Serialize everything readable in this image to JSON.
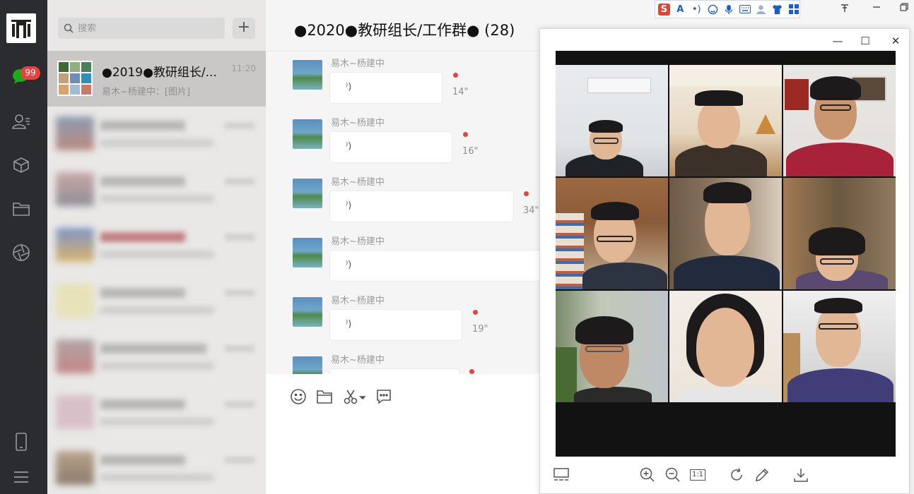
{
  "sidebar": {
    "unread_count": "99",
    "icons": [
      "chat-icon",
      "contacts-icon",
      "favorites-icon",
      "files-icon",
      "moments-icon",
      "phone-icon",
      "menu-icon"
    ]
  },
  "search": {
    "placeholder": "搜索",
    "add_label": "+"
  },
  "conversations": {
    "active": {
      "name": "●2019●教研组长/...",
      "time": "11:20",
      "preview": "易木~杨建中：[图片]"
    }
  },
  "chat": {
    "title": "●2020●教研组长/工作群● (28)",
    "messages": [
      {
        "sender": "易木~杨建中",
        "duration": "14\"",
        "wave": "⁾)"
      },
      {
        "sender": "易木~杨建中",
        "duration": "16\"",
        "wave": "⁾)"
      },
      {
        "sender": "易木~杨建中",
        "duration": "34\"",
        "wave": "⁾)"
      },
      {
        "sender": "易木~杨建中",
        "duration": "",
        "wave": "⁾)"
      },
      {
        "sender": "易木~杨建中",
        "duration": "19\"",
        "wave": "⁾)"
      },
      {
        "sender": "易木~杨建中",
        "duration": "",
        "wave": "⁾)"
      }
    ]
  },
  "ime": {
    "brand": "S",
    "font_label": "A",
    "punct_label": "•)"
  },
  "viewer": {
    "minimize": "—",
    "maximize": "☐",
    "close": "✕",
    "actual_size_label": "1:1"
  },
  "colors": {
    "accent_red": "#e64340",
    "rail_bg": "#2b2c30",
    "green": "#1aad19"
  }
}
